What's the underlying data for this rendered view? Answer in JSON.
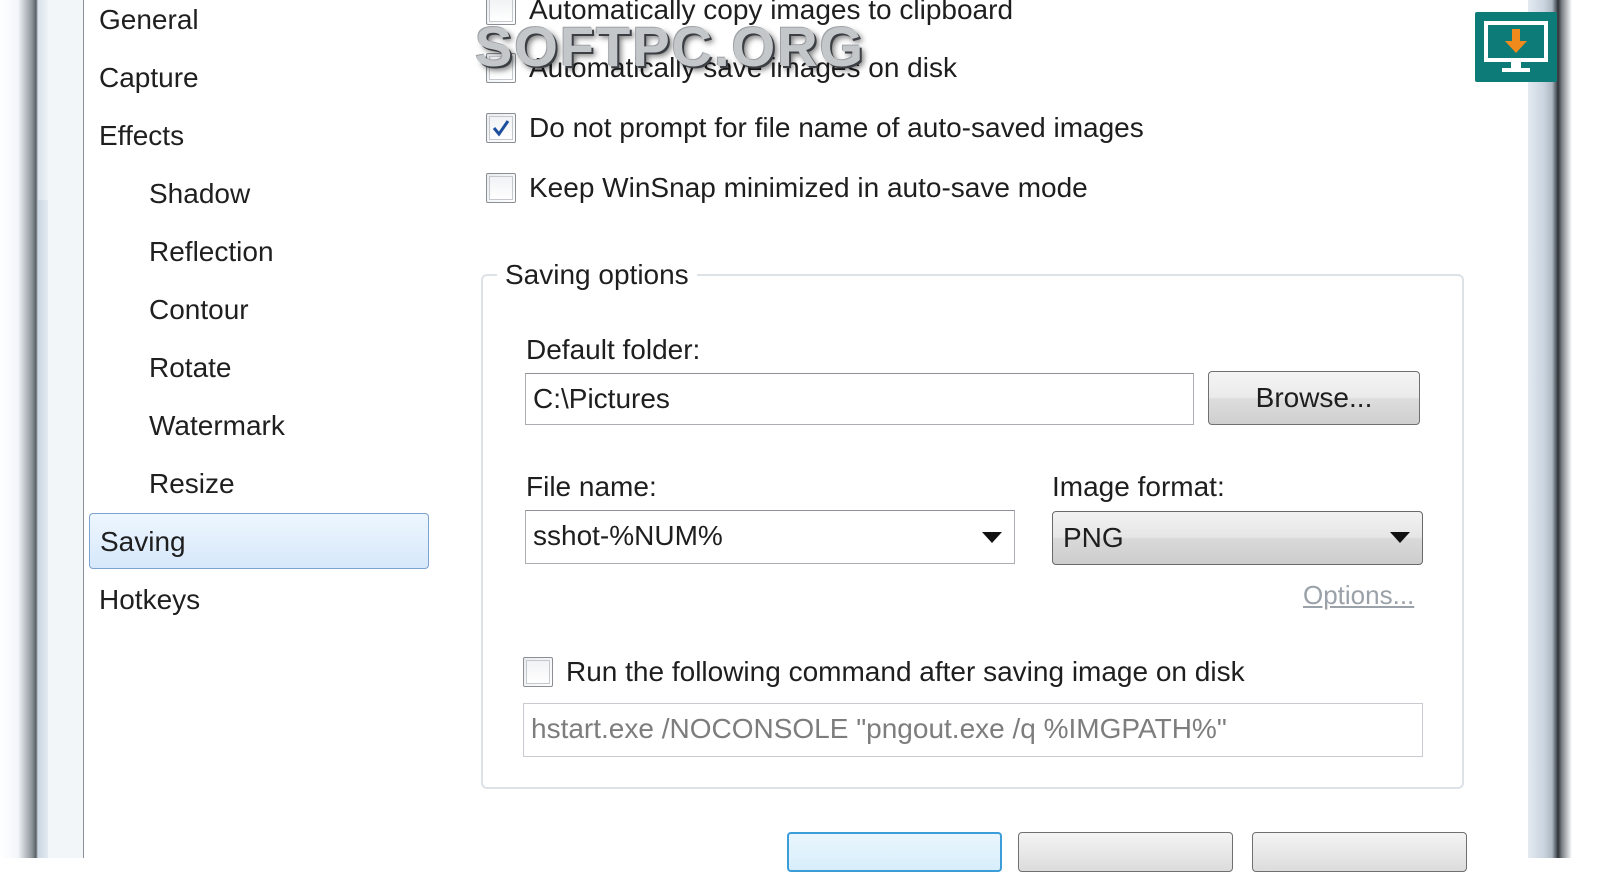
{
  "nav": {
    "items": [
      {
        "label": "General",
        "level": 0,
        "selected": false
      },
      {
        "label": "Capture",
        "level": 0,
        "selected": false
      },
      {
        "label": "Effects",
        "level": 0,
        "selected": false
      },
      {
        "label": "Shadow",
        "level": 1,
        "selected": false
      },
      {
        "label": "Reflection",
        "level": 1,
        "selected": false
      },
      {
        "label": "Contour",
        "level": 1,
        "selected": false
      },
      {
        "label": "Rotate",
        "level": 1,
        "selected": false
      },
      {
        "label": "Watermark",
        "level": 1,
        "selected": false
      },
      {
        "label": "Resize",
        "level": 1,
        "selected": false
      },
      {
        "label": "Saving",
        "level": 0,
        "selected": true
      },
      {
        "label": "Hotkeys",
        "level": 0,
        "selected": false
      }
    ]
  },
  "options": {
    "auto_copy": {
      "label": "Automatically copy images to clipboard",
      "checked": false
    },
    "auto_save": {
      "label": "Automatically save images on disk",
      "checked": false
    },
    "no_prompt": {
      "label": "Do not prompt for file name of auto-saved images",
      "checked": true
    },
    "keep_minimized": {
      "label": "Keep WinSnap minimized in auto-save mode",
      "checked": false
    }
  },
  "saving": {
    "group_title": "Saving options",
    "default_folder_label": "Default folder:",
    "default_folder_value": "C:\\Pictures",
    "browse_label": "Browse...",
    "file_name_label": "File name:",
    "file_name_value": "sshot-%NUM%",
    "image_format_label": "Image format:",
    "image_format_value": "PNG",
    "options_link": "Options...",
    "run_command": {
      "label": "Run the following command after saving image on disk",
      "checked": false
    },
    "command_value": "hstart.exe /NOCONSOLE \"pngout.exe /q %IMGPATH%\""
  },
  "watermark_text": "SOFTPC.ORG",
  "colors": {
    "selection_border": "#7da2ce",
    "checkmark": "#1d4f9e",
    "logo_bg": "#0d7c78",
    "logo_arrow": "#f08a1c"
  }
}
